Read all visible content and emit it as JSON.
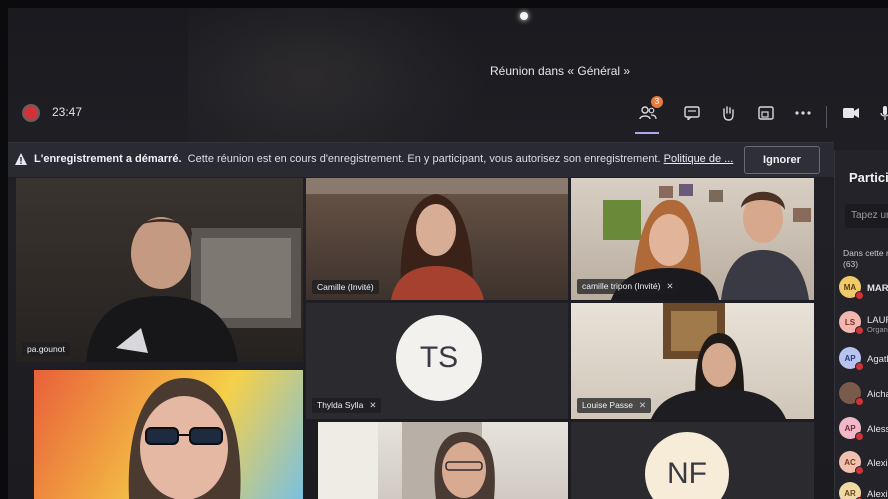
{
  "window": {
    "title": "Réunion dans « Général »"
  },
  "controls": {
    "timer": "23:47",
    "participants_badge": "3"
  },
  "banner": {
    "heading": "L'enregistrement a démarré.",
    "message": "Cette réunion est en cours d'enregistrement. En y participant, vous autorisez son enregistrement.",
    "link": "Politique de ...",
    "ignore_label": "Ignorer"
  },
  "tiles": [
    {
      "name": "pa.gounot"
    },
    {
      "name": "Camille (Invité)"
    },
    {
      "name": "camille tripon (Invité)"
    },
    {
      "name": "Thylda Sylla",
      "initials": "TS"
    },
    {
      "name": "Louise Passe"
    },
    {
      "name": ""
    },
    {
      "name": ""
    },
    {
      "name": "",
      "initials": "NF"
    }
  ],
  "sidebar": {
    "header": "Particip",
    "search_placeholder": "Tapez un",
    "section_label": "Dans cette ré",
    "section_count": "(63)",
    "participants": [
      {
        "initials": "MA",
        "name": "MARI",
        "sub": "",
        "color": "#f0c96a"
      },
      {
        "initials": "LS",
        "name": "LAURE",
        "sub": "Organi",
        "color": "#f2b8b0"
      },
      {
        "initials": "AP",
        "name": "Agathe",
        "sub": "",
        "color": "#b8c4f0"
      },
      {
        "initials": "",
        "name": "Aicha Bo",
        "sub": "",
        "color": "#7a5a4a"
      },
      {
        "initials": "AP",
        "name": "Alessand",
        "sub": "",
        "color": "#f0b8c8"
      },
      {
        "initials": "AC",
        "name": "Alexis Co",
        "sub": "",
        "color": "#f0c0b0"
      },
      {
        "initials": "AR",
        "name": "Alexis Ric",
        "sub": "",
        "color": "#f0d8a8"
      }
    ]
  }
}
